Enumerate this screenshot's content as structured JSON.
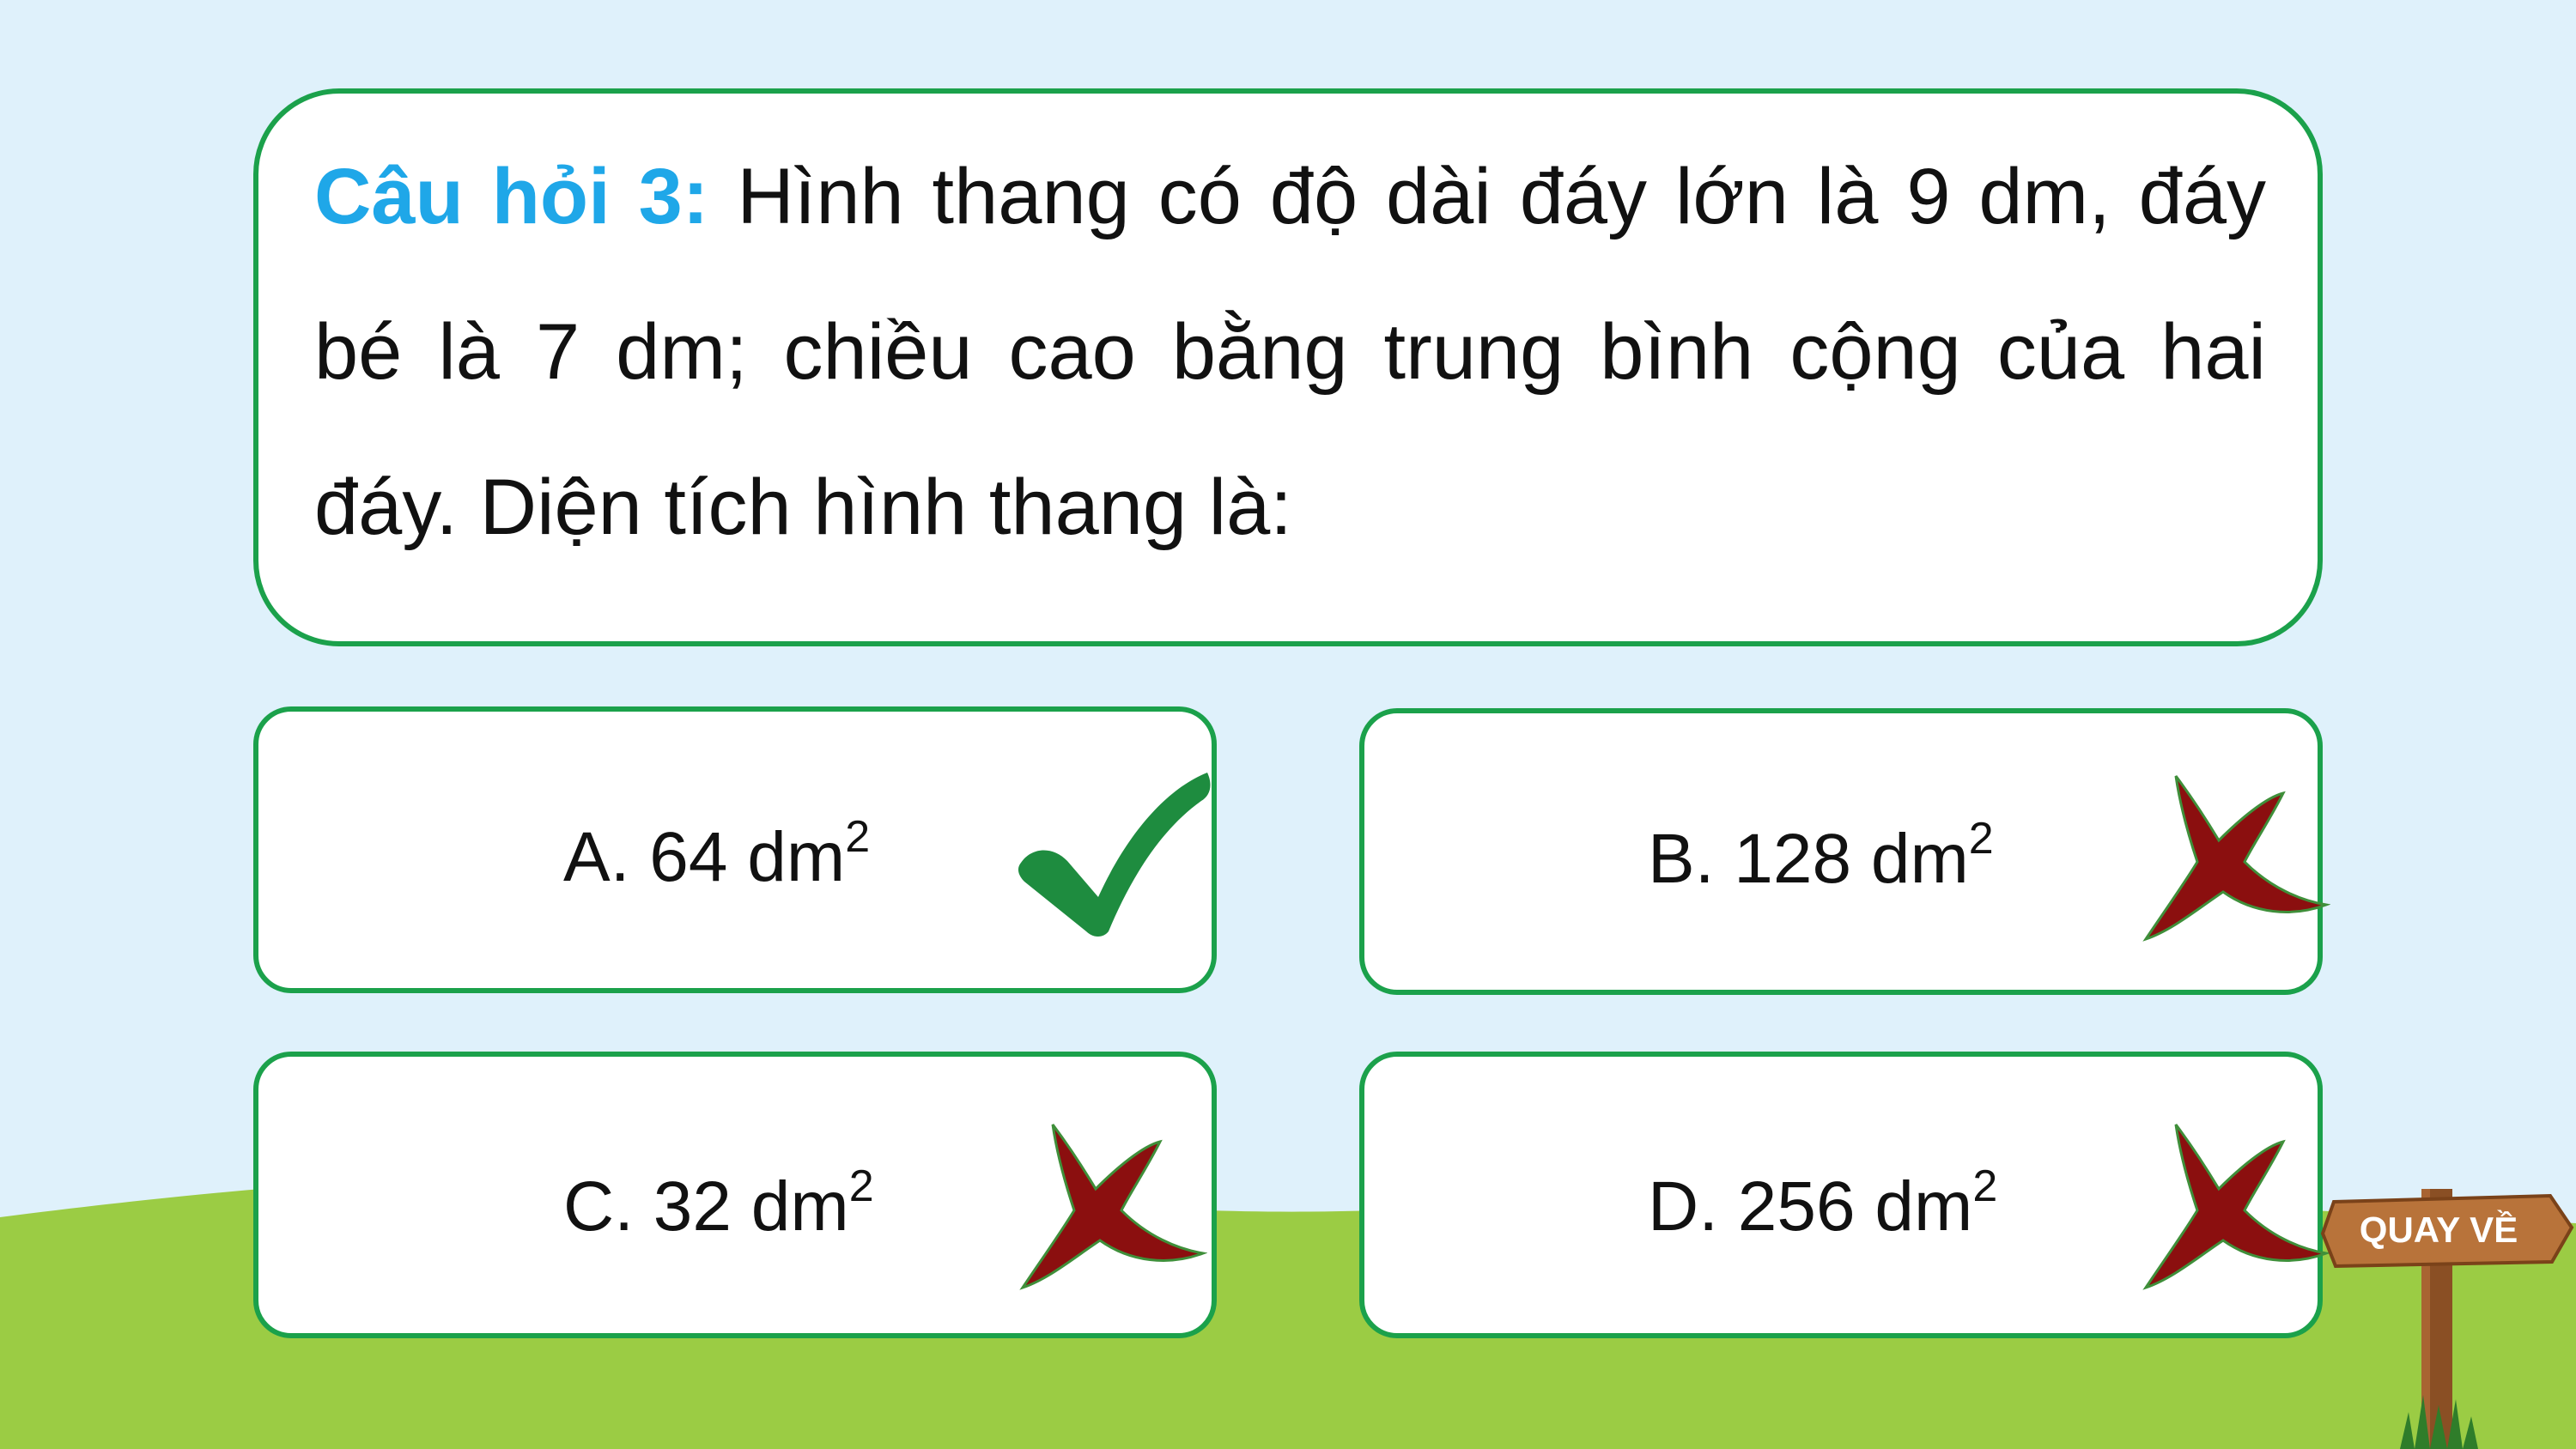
{
  "question": {
    "label": "Câu hỏi 3:",
    "text": "Hình thang có độ dài đáy lớn là 9 dm, đáy bé là 7 dm; chiều cao bằng trung bình cộng của hai đáy. Diện tích hình thang là:"
  },
  "answers": [
    {
      "letter": "A.",
      "value": "64 dm",
      "unit_power": "2",
      "mark": "check-icon"
    },
    {
      "letter": "B.",
      "value": "128 dm",
      "unit_power": "2",
      "mark": "cross-icon"
    },
    {
      "letter": "C.",
      "value": "32 dm",
      "unit_power": "2",
      "mark": "cross-icon"
    },
    {
      "letter": "D.",
      "value": "256 dm",
      "unit_power": "2",
      "mark": "cross-icon"
    }
  ],
  "back_button": {
    "label": "QUAY VỀ"
  },
  "colors": {
    "sky": "#dff1fb",
    "grass": "#9bcc44",
    "card_border": "#1ba14b",
    "question_label": "#1fa7e8",
    "check": "#1e8c3f",
    "cross": "#8b0f0f",
    "sign_wood": "#b8733a"
  }
}
